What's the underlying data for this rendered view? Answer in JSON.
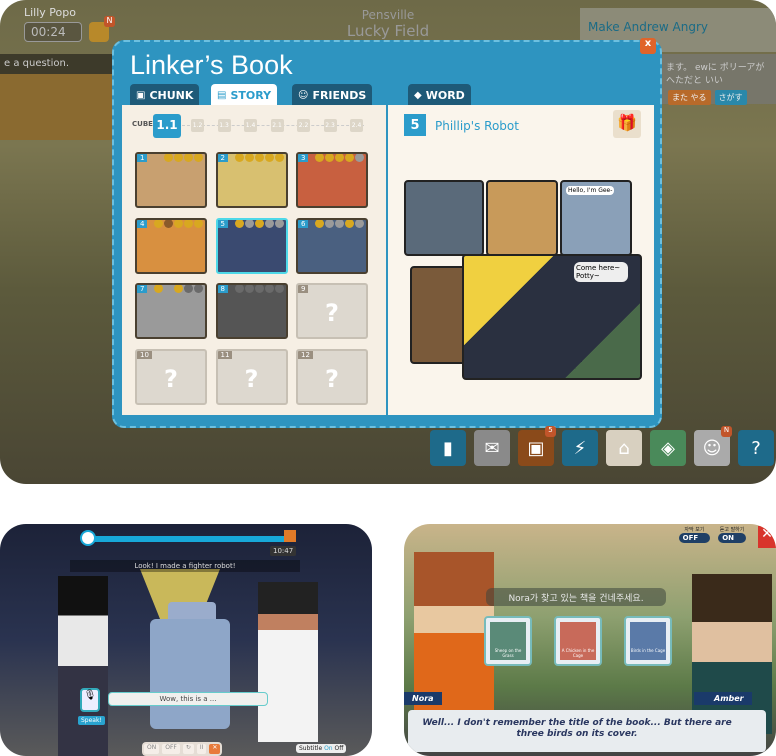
{
  "main_screen": {
    "player_name": "Lilly Popo",
    "timer": "00:24",
    "notification_badge": "N",
    "location": {
      "region": "Pensville",
      "area": "Lucky Field"
    },
    "quest_title": "Make Andrew Angry",
    "side_prompt": "e a question.",
    "japanese_text": "ます。\newに ポリーアが へただと いい",
    "japanese_buttons": [
      "また やる",
      "さがす"
    ],
    "book": {
      "title": "Linker’s Book",
      "close_label": "x",
      "tabs": [
        {
          "label": "CHUNK",
          "icon": "cube-icon"
        },
        {
          "label": "STORY",
          "icon": "film-icon",
          "active": true
        },
        {
          "label": "FRIENDS",
          "icon": "friends-icon"
        },
        {
          "label": "WORD",
          "icon": "word-icon"
        }
      ],
      "cube_label": "CUBE",
      "cubes": [
        "1.1",
        "1.2",
        "1.3",
        "1.4",
        "2.1",
        "2.2",
        "2.3",
        "2.4"
      ],
      "selected_cube": "1.1",
      "episodes": [
        {
          "num": "1",
          "medals": [
            "gold",
            "gold",
            "gold",
            "gold"
          ],
          "color": "#c8a070"
        },
        {
          "num": "2",
          "medals": [
            "gold",
            "gold",
            "gold",
            "gold",
            "gold"
          ],
          "color": "#d8c070"
        },
        {
          "num": "3",
          "medals": [
            "gold",
            "gold",
            "gold",
            "gold",
            "silver"
          ],
          "color": "#c86040"
        },
        {
          "num": "4",
          "medals": [
            "gold",
            "bronze",
            "gold",
            "gold",
            "gold"
          ],
          "color": "#d89040"
        },
        {
          "num": "5",
          "medals": [
            "gold",
            "silver",
            "gold",
            "silver",
            "silver"
          ],
          "color": "#3a4a70",
          "selected": true
        },
        {
          "num": "6",
          "medals": [
            "gold",
            "silver",
            "silver",
            "gold",
            "silver"
          ],
          "color": "#4a6080"
        },
        {
          "num": "7",
          "medals": [
            "gold",
            "silver",
            "gold",
            "empty",
            "empty"
          ],
          "color": "#9a9a9a"
        },
        {
          "num": "8",
          "medals": [
            "empty",
            "empty",
            "empty",
            "empty",
            "empty"
          ],
          "color": "#555"
        },
        {
          "num": "9",
          "locked": true,
          "placeholder": "?"
        },
        {
          "num": "10",
          "locked": true,
          "placeholder": "?"
        },
        {
          "num": "11",
          "locked": true,
          "placeholder": "?"
        },
        {
          "num": "12",
          "locked": true,
          "placeholder": "?"
        }
      ],
      "selected_episode": {
        "num": "5",
        "title": "Phillip's Robot",
        "reward_icon": "gift-box-icon"
      },
      "comic_bubbles": [
        "Hello, I'm Gee-",
        "Come here~ Potty~"
      ]
    },
    "hud_buttons": [
      {
        "icon": "notebook-icon"
      },
      {
        "icon": "mail-icon"
      },
      {
        "icon": "backpack-icon",
        "badge": "5"
      },
      {
        "icon": "lightning-icon"
      },
      {
        "icon": "house-icon"
      },
      {
        "icon": "map-icon"
      },
      {
        "icon": "avatar-icon",
        "badge": "N"
      },
      {
        "icon": "help-icon",
        "glyph": "?"
      }
    ]
  },
  "speaking_screen": {
    "timestamp": "10:47",
    "subtitle_top": "Look! I made a fighter robot!",
    "speech_bubble": "Wow, this is a ...",
    "speak_label": "Speak!",
    "controls": [
      "ON",
      "OFF",
      "↻",
      "II",
      "✕"
    ],
    "subtitle_toggle": {
      "label": "Subtitle",
      "on": "On",
      "off": "Off"
    }
  },
  "book_quest_screen": {
    "toggles": [
      {
        "label": "자막 보기",
        "value": "OFF"
      },
      {
        "label": "듣고 말하기",
        "value": "ON"
      }
    ],
    "prompt": "Nora가 찾고 있는 책을 건네주세요.",
    "books": [
      {
        "title": "Sheep on the Grass",
        "color": "#5a8a78"
      },
      {
        "title": "A Chicken in the Cage",
        "color": "#c86a5a"
      },
      {
        "title": "Birds in the Cage",
        "color": "#5a7aa8"
      }
    ],
    "speaker_left": "Nora",
    "speaker_right": "Amber",
    "dialogue": "Well... I don't remember the title of the book... But there are three birds on its cover."
  },
  "colors": {
    "accent": "#2b9ccb",
    "close": "#e0642a",
    "gold": "#d8a820",
    "silver": "#9a9a9a"
  }
}
